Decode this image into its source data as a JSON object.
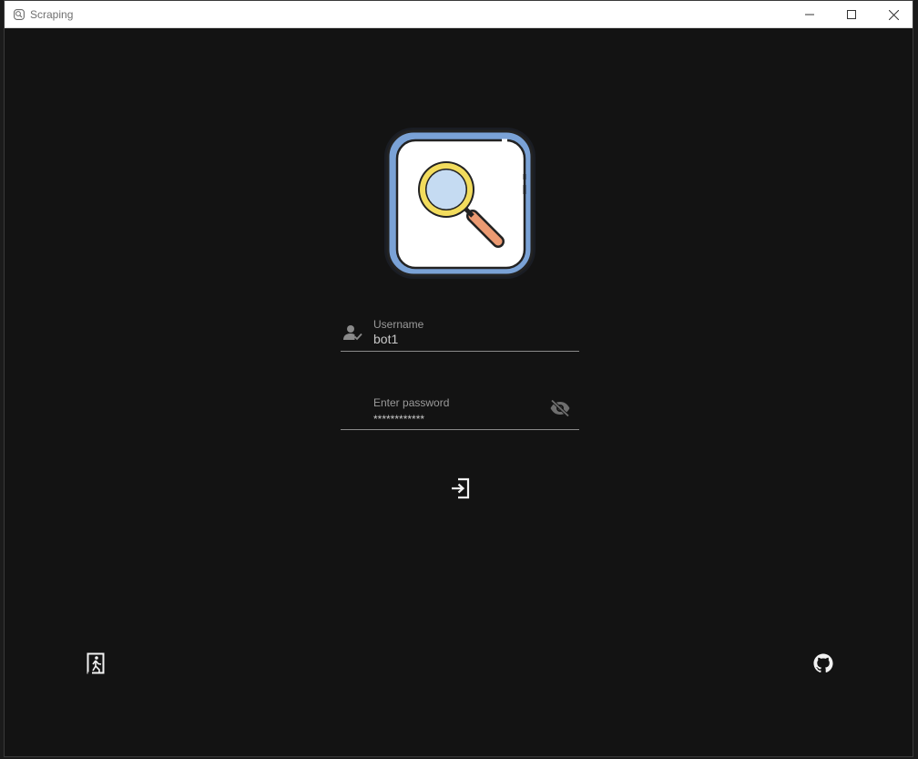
{
  "window": {
    "title": "Scraping"
  },
  "logo": {
    "icon": "magnifier-logo-icon",
    "colors": {
      "frame": "#7aa2d6",
      "inner": "#ffffff",
      "lens": "#c5dbf2",
      "ring": "#f2dc5d",
      "handle": "#eb9a72"
    }
  },
  "form": {
    "username": {
      "label": "Username",
      "value": "bot1",
      "icon": "user-check-icon"
    },
    "password": {
      "label": "Enter password",
      "value": "************",
      "icon": "eye-off-icon"
    },
    "login_icon": "login-icon"
  },
  "footer": {
    "exit_icon": "exit-door-icon",
    "github_icon": "github-icon"
  },
  "colors": {
    "background": "#131313",
    "text": "#c8c8c8",
    "label": "#9a9a9a"
  }
}
